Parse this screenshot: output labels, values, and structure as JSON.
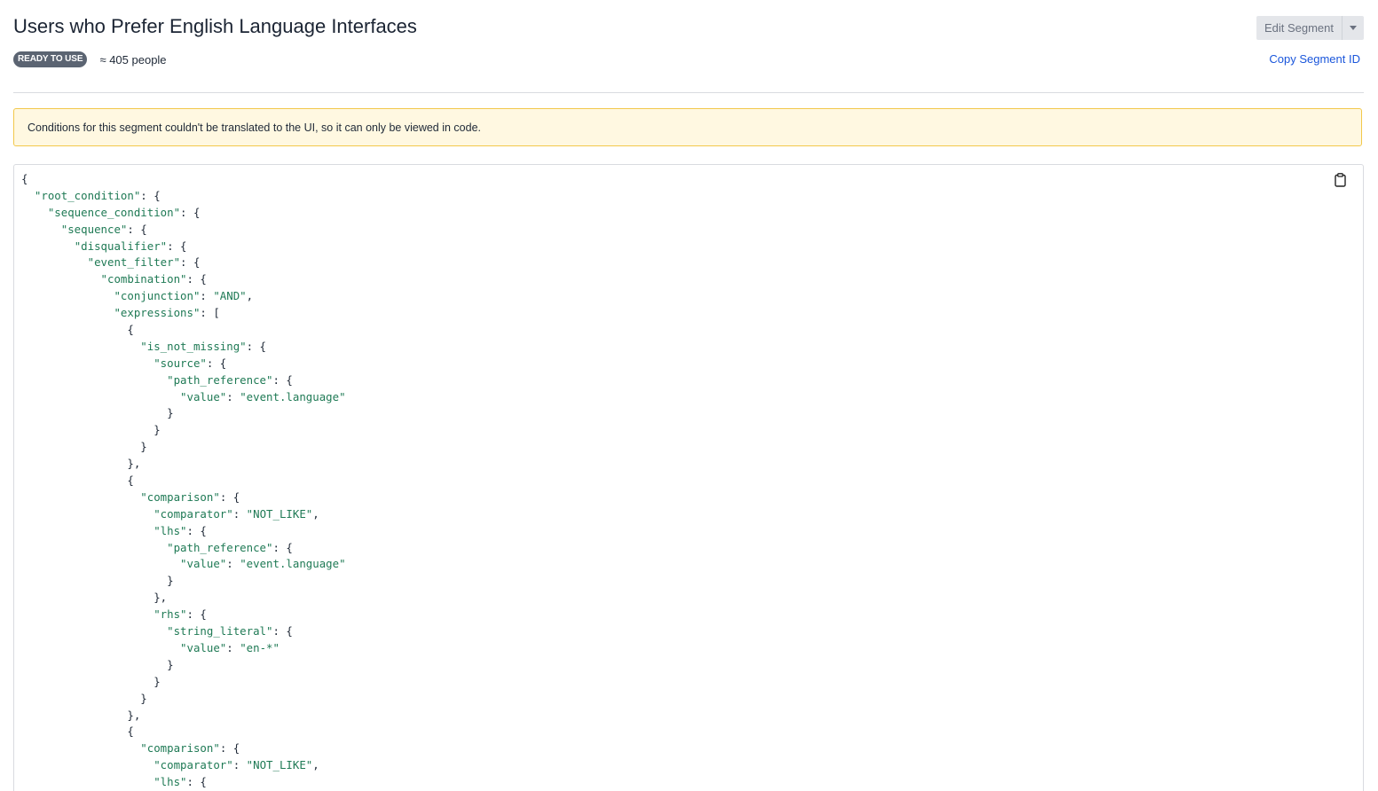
{
  "header": {
    "title": "Users who Prefer English Language Interfaces",
    "badge": "READY TO USE",
    "count": "≈ 405 people",
    "edit_button": "Edit Segment",
    "copy_link": "Copy Segment ID"
  },
  "warning": {
    "text": "Conditions for this segment couldn't be translated to the UI, so it can only be viewed in code."
  },
  "code": {
    "lines": [
      {
        "indent": 0,
        "tokens": [
          [
            "p",
            "{"
          ]
        ]
      },
      {
        "indent": 1,
        "tokens": [
          [
            "k",
            "\"root_condition\""
          ],
          [
            "p",
            ": {"
          ]
        ]
      },
      {
        "indent": 2,
        "tokens": [
          [
            "k",
            "\"sequence_condition\""
          ],
          [
            "p",
            ": {"
          ]
        ]
      },
      {
        "indent": 3,
        "tokens": [
          [
            "k",
            "\"sequence\""
          ],
          [
            "p",
            ": {"
          ]
        ]
      },
      {
        "indent": 4,
        "tokens": [
          [
            "k",
            "\"disqualifier\""
          ],
          [
            "p",
            ": {"
          ]
        ]
      },
      {
        "indent": 5,
        "tokens": [
          [
            "k",
            "\"event_filter\""
          ],
          [
            "p",
            ": {"
          ]
        ]
      },
      {
        "indent": 6,
        "tokens": [
          [
            "k",
            "\"combination\""
          ],
          [
            "p",
            ": {"
          ]
        ]
      },
      {
        "indent": 7,
        "tokens": [
          [
            "k",
            "\"conjunction\""
          ],
          [
            "p",
            ": "
          ],
          [
            "s",
            "\"AND\""
          ],
          [
            "p",
            ","
          ]
        ]
      },
      {
        "indent": 7,
        "tokens": [
          [
            "k",
            "\"expressions\""
          ],
          [
            "p",
            ": ["
          ]
        ]
      },
      {
        "indent": 8,
        "tokens": [
          [
            "p",
            "{"
          ]
        ]
      },
      {
        "indent": 9,
        "tokens": [
          [
            "k",
            "\"is_not_missing\""
          ],
          [
            "p",
            ": {"
          ]
        ]
      },
      {
        "indent": 10,
        "tokens": [
          [
            "k",
            "\"source\""
          ],
          [
            "p",
            ": {"
          ]
        ]
      },
      {
        "indent": 11,
        "tokens": [
          [
            "k",
            "\"path_reference\""
          ],
          [
            "p",
            ": {"
          ]
        ]
      },
      {
        "indent": 12,
        "tokens": [
          [
            "k",
            "\"value\""
          ],
          [
            "p",
            ": "
          ],
          [
            "s",
            "\"event.language\""
          ]
        ]
      },
      {
        "indent": 11,
        "tokens": [
          [
            "p",
            "}"
          ]
        ]
      },
      {
        "indent": 10,
        "tokens": [
          [
            "p",
            "}"
          ]
        ]
      },
      {
        "indent": 9,
        "tokens": [
          [
            "p",
            "}"
          ]
        ]
      },
      {
        "indent": 8,
        "tokens": [
          [
            "p",
            "},"
          ]
        ]
      },
      {
        "indent": 8,
        "tokens": [
          [
            "p",
            "{"
          ]
        ]
      },
      {
        "indent": 9,
        "tokens": [
          [
            "k",
            "\"comparison\""
          ],
          [
            "p",
            ": {"
          ]
        ]
      },
      {
        "indent": 10,
        "tokens": [
          [
            "k",
            "\"comparator\""
          ],
          [
            "p",
            ": "
          ],
          [
            "s",
            "\"NOT_LIKE\""
          ],
          [
            "p",
            ","
          ]
        ]
      },
      {
        "indent": 10,
        "tokens": [
          [
            "k",
            "\"lhs\""
          ],
          [
            "p",
            ": {"
          ]
        ]
      },
      {
        "indent": 11,
        "tokens": [
          [
            "k",
            "\"path_reference\""
          ],
          [
            "p",
            ": {"
          ]
        ]
      },
      {
        "indent": 12,
        "tokens": [
          [
            "k",
            "\"value\""
          ],
          [
            "p",
            ": "
          ],
          [
            "s",
            "\"event.language\""
          ]
        ]
      },
      {
        "indent": 11,
        "tokens": [
          [
            "p",
            "}"
          ]
        ]
      },
      {
        "indent": 10,
        "tokens": [
          [
            "p",
            "},"
          ]
        ]
      },
      {
        "indent": 10,
        "tokens": [
          [
            "k",
            "\"rhs\""
          ],
          [
            "p",
            ": {"
          ]
        ]
      },
      {
        "indent": 11,
        "tokens": [
          [
            "k",
            "\"string_literal\""
          ],
          [
            "p",
            ": {"
          ]
        ]
      },
      {
        "indent": 12,
        "tokens": [
          [
            "k",
            "\"value\""
          ],
          [
            "p",
            ": "
          ],
          [
            "s",
            "\"en-*\""
          ]
        ]
      },
      {
        "indent": 11,
        "tokens": [
          [
            "p",
            "}"
          ]
        ]
      },
      {
        "indent": 10,
        "tokens": [
          [
            "p",
            "}"
          ]
        ]
      },
      {
        "indent": 9,
        "tokens": [
          [
            "p",
            "}"
          ]
        ]
      },
      {
        "indent": 8,
        "tokens": [
          [
            "p",
            "},"
          ]
        ]
      },
      {
        "indent": 8,
        "tokens": [
          [
            "p",
            "{"
          ]
        ]
      },
      {
        "indent": 9,
        "tokens": [
          [
            "k",
            "\"comparison\""
          ],
          [
            "p",
            ": {"
          ]
        ]
      },
      {
        "indent": 10,
        "tokens": [
          [
            "k",
            "\"comparator\""
          ],
          [
            "p",
            ": "
          ],
          [
            "s",
            "\"NOT_LIKE\""
          ],
          [
            "p",
            ","
          ]
        ]
      },
      {
        "indent": 10,
        "tokens": [
          [
            "k",
            "\"lhs\""
          ],
          [
            "p",
            ": {"
          ]
        ]
      }
    ]
  },
  "icons": {
    "clipboard": "clipboard-icon",
    "caret": "chevron-down-icon"
  },
  "colors": {
    "badge_bg": "#5b6472",
    "link": "#1a56db",
    "warning_bg": "#fff8e1",
    "warning_border": "#f2c84b",
    "code_key": "#1f7a55"
  }
}
